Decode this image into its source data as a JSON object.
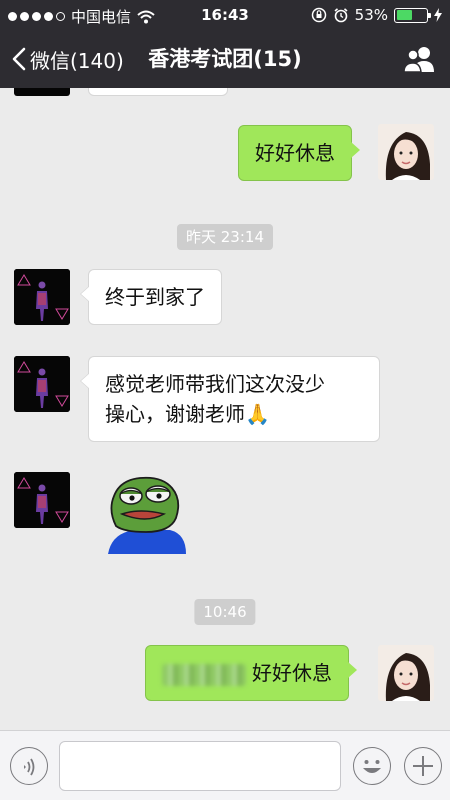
{
  "status_bar": {
    "carrier": "中国电信",
    "time": "16:43",
    "battery_percent": "53%",
    "battery_level": 0.53
  },
  "nav": {
    "back_label": "微信(140)",
    "title": "香港考试团(15)"
  },
  "messages": [
    {
      "id": "m1",
      "direction": "out",
      "text": "好好休息"
    },
    {
      "id": "t1",
      "type": "time",
      "text": "昨天 23:14"
    },
    {
      "id": "m2",
      "direction": "in",
      "text": "终于到家了"
    },
    {
      "id": "m3",
      "direction": "in",
      "line1": "感觉老师带我们这次没少",
      "line2": "操心，谢谢老师",
      "emoji": "🙏"
    },
    {
      "id": "m4",
      "direction": "in",
      "type": "sticker",
      "sticker": "pepe-frog-sticker"
    },
    {
      "id": "t2",
      "type": "time",
      "text": "10:46"
    },
    {
      "id": "m5",
      "direction": "out",
      "text": "好好休息",
      "mention_blurred": true
    }
  ],
  "input": {
    "placeholder": ""
  },
  "colors": {
    "bar": "#2d2c31",
    "chat_bg": "#ebebeb",
    "bubble_out": "#a0e75a",
    "bubble_in": "#ffffff",
    "time_chip": "#cecece"
  }
}
